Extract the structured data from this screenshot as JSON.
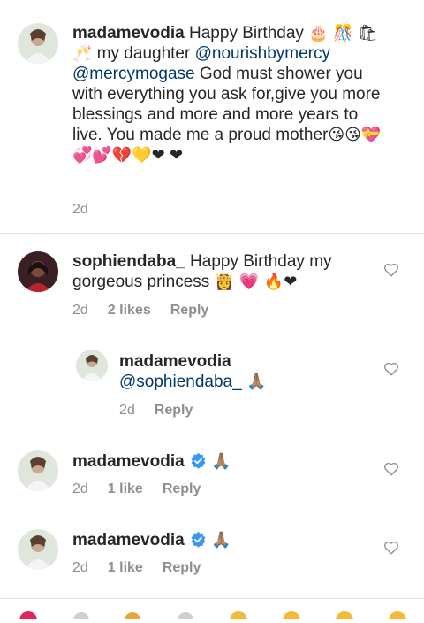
{
  "comments": [
    {
      "username": "madamevodia",
      "text_before": "Happy Birthday ",
      "emoji_1": "🎂 🎊",
      "emoji_2": "🛍🥂",
      "text_mid": " my daughter ",
      "mention_1": "@nourishbymercy",
      "mention_2": "@mercymogase",
      "text_after": " God must shower you with everything you ask for,give you more blessings and more and more years to live. You made me a proud mother",
      "emoji_3": "😘😘💝💞💕💔💛❤",
      "emoji_4": "❤",
      "time": "2d"
    },
    {
      "username": "sophiendaba_",
      "text": " Happy Birthday my gorgeous princess ",
      "emoji": "👸 💗 🔥❤",
      "time": "2d",
      "likes": "2 likes",
      "reply": "Reply"
    },
    {
      "username": "madamevodia",
      "mention": "@sophiendaba_",
      "emoji": " 🙏🏽",
      "time": "2d",
      "reply": "Reply"
    },
    {
      "username": "madamevodia",
      "emoji": "🙏🏽",
      "time": "2d",
      "likes": "1 like",
      "reply": "Reply"
    },
    {
      "username": "madamevodia",
      "emoji": "🙏🏽",
      "time": "2d",
      "likes": "1 like",
      "reply": "Reply"
    }
  ],
  "colors": {
    "link": "#00376b",
    "meta": "#8e8e8e",
    "verified": "#3897f0"
  },
  "icons": [
    "heart-icon",
    "verified-badge-icon"
  ]
}
